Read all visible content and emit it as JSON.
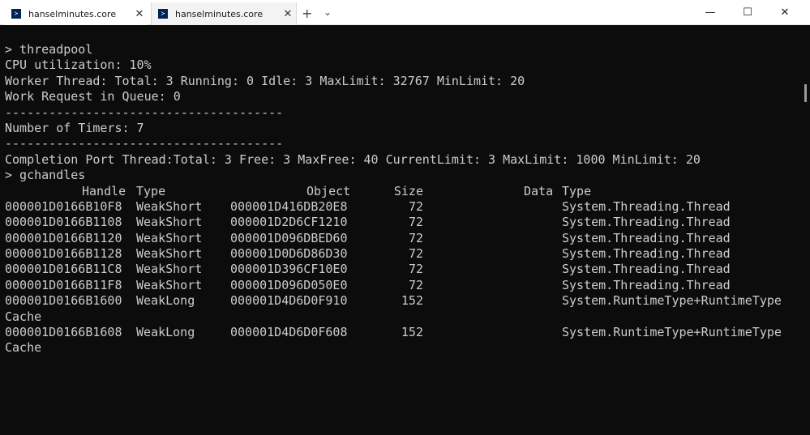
{
  "tabs": [
    {
      "label": "hanselminutes.core",
      "close": "✕",
      "icon_glyph": "≻"
    },
    {
      "label": "hanselminutes.core",
      "close": "✕",
      "icon_glyph": "≻"
    }
  ],
  "tabbar": {
    "new_tab": "+",
    "dropdown": "⌄"
  },
  "window": {
    "minimize": "—",
    "maximize": "☐",
    "close": "✕"
  },
  "terminal": {
    "lines": [
      "> threadpool",
      "CPU utilization: 10%",
      "Worker Thread: Total: 3 Running: 0 Idle: 3 MaxLimit: 32767 MinLimit: 20",
      "Work Request in Queue: 0",
      "--------------------------------------",
      "Number of Timers: 7",
      "--------------------------------------",
      "Completion Port Thread:Total: 3 Free: 3 MaxFree: 40 CurrentLimit: 3 MaxLimit: 1000 MinLimit: 20",
      "> gchandles"
    ],
    "table": {
      "headers": {
        "handle": "Handle",
        "type": "Type",
        "object": "Object",
        "size": "Size",
        "data": "Data",
        "dtype": "Type"
      },
      "rows": [
        {
          "handle": "000001D0166B10F8",
          "type": "WeakShort",
          "object": "000001D416DB20E8",
          "size": "72",
          "dtype": "System.Threading.Thread"
        },
        {
          "handle": "000001D0166B1108",
          "type": "WeakShort",
          "object": "000001D2D6CF1210",
          "size": "72",
          "dtype": "System.Threading.Thread"
        },
        {
          "handle": "000001D0166B1120",
          "type": "WeakShort",
          "object": "000001D096DBED60",
          "size": "72",
          "dtype": "System.Threading.Thread"
        },
        {
          "handle": "000001D0166B1128",
          "type": "WeakShort",
          "object": "000001D0D6D86D30",
          "size": "72",
          "dtype": "System.Threading.Thread"
        },
        {
          "handle": "000001D0166B11C8",
          "type": "WeakShort",
          "object": "000001D396CF10E0",
          "size": "72",
          "dtype": "System.Threading.Thread"
        },
        {
          "handle": "000001D0166B11F8",
          "type": "WeakShort",
          "object": "000001D096D050E0",
          "size": "72",
          "dtype": "System.Threading.Thread"
        },
        {
          "handle": "000001D0166B1600",
          "type": "WeakLong",
          "object": "000001D4D6D0F910",
          "size": "152",
          "dtype": "System.RuntimeType+RuntimeType",
          "wrap": "Cache"
        },
        {
          "handle": "000001D0166B1608",
          "type": "WeakLong",
          "object": "000001D4D6D0F608",
          "size": "152",
          "dtype": "System.RuntimeType+RuntimeType",
          "wrap": "Cache"
        }
      ]
    }
  },
  "colors": {
    "terminal_bg": "#0c0c0c",
    "terminal_fg": "#cccccc",
    "ps_icon": "#012456"
  }
}
